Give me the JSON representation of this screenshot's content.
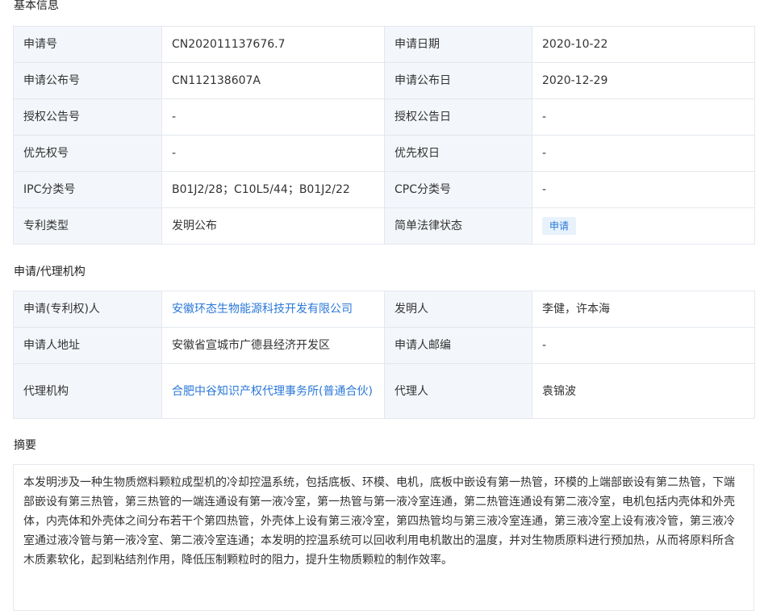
{
  "sections": {
    "basic": "基本信息",
    "agency": "申请/代理机构",
    "abstract": "摘要"
  },
  "basic": {
    "app_no_label": "申请号",
    "app_no": "CN202011137676.7",
    "app_date_label": "申请日期",
    "app_date": "2020-10-22",
    "pub_no_label": "申请公布号",
    "pub_no": "CN112138607A",
    "pub_date_label": "申请公布日",
    "pub_date": "2020-12-29",
    "grant_no_label": "授权公告号",
    "grant_no": "-",
    "grant_date_label": "授权公告日",
    "grant_date": "-",
    "priority_no_label": "优先权号",
    "priority_no": "-",
    "priority_date_label": "优先权日",
    "priority_date": "-",
    "ipc_label": "IPC分类号",
    "ipc": "B01J2/28；C10L5/44；B01J2/22",
    "cpc_label": "CPC分类号",
    "cpc": "-",
    "type_label": "专利类型",
    "type": "发明公布",
    "legal_label": "简单法律状态",
    "legal": "申请"
  },
  "agency": {
    "applicant_label": "申请(专利权)人",
    "applicant": "安徽环态生物能源科技开发有限公司",
    "inventor_label": "发明人",
    "inventor": "李健，许本海",
    "address_label": "申请人地址",
    "address": "安徽省宣城市广德县经济开发区",
    "postcode_label": "申请人邮编",
    "postcode": "-",
    "agency_label": "代理机构",
    "agency": "合肥中谷知识产权代理事务所(普通合伙)",
    "agent_label": "代理人",
    "agent": "袁锦波"
  },
  "abstract": {
    "text": "本发明涉及一种生物质燃料颗粒成型机的冷却控温系统，包括底板、环模、电机，底板中嵌设有第一热管，环模的上端部嵌设有第二热管，下端部嵌设有第三热管，第三热管的一端连通设有第一液冷室，第一热管与第一液冷室连通，第二热管连通设有第二液冷室，电机包括内壳体和外壳体，内壳体和外壳体之间分布若干个第四热管，外壳体上设有第三液冷室，第四热管均与第三液冷室连通，第三液冷室上设有液冷管，第三液冷室通过液冷管与第一液冷室、第二液冷室连通；本发明的控温系统可以回收利用电机散出的温度，并对生物质原料进行预加热，从而将原料所含木质素软化，起到粘结剂作用，降低压制颗粒时的阻力，提升生物质颗粒的制作效率。"
  },
  "colors": {
    "link": "#2b78d8",
    "label_bg": "#f3f6fa",
    "border": "#e4e8ee",
    "badge_bg": "#e8f2fc"
  }
}
